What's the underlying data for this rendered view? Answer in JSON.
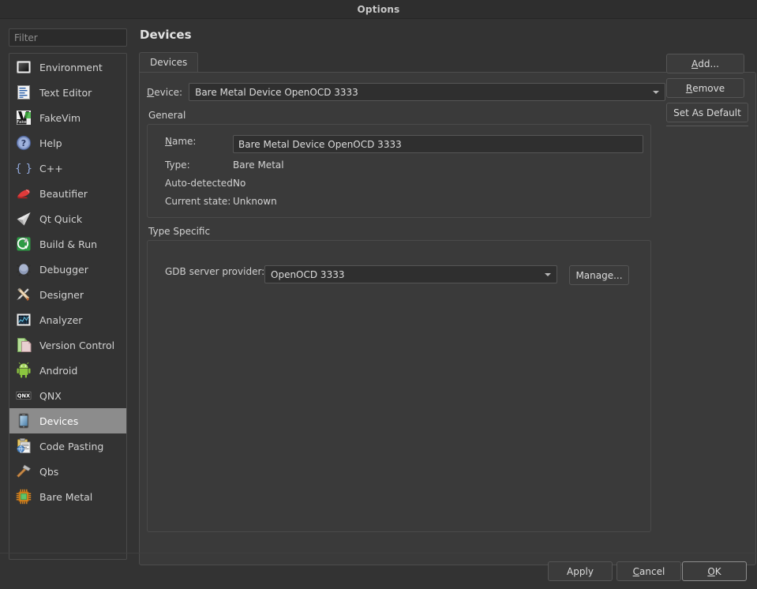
{
  "window": {
    "title": "Options"
  },
  "sidebar": {
    "filter": {
      "placeholder": "Filter",
      "value": ""
    },
    "items": [
      {
        "label": "Environment",
        "icon": "environment-icon",
        "selected": false
      },
      {
        "label": "Text Editor",
        "icon": "text-editor-icon",
        "selected": false
      },
      {
        "label": "FakeVim",
        "icon": "fakevim-icon",
        "selected": false
      },
      {
        "label": "Help",
        "icon": "help-icon",
        "selected": false
      },
      {
        "label": "C++",
        "icon": "cpp-icon",
        "selected": false
      },
      {
        "label": "Beautifier",
        "icon": "beautifier-icon",
        "selected": false
      },
      {
        "label": "Qt Quick",
        "icon": "qt-quick-icon",
        "selected": false
      },
      {
        "label": "Build & Run",
        "icon": "build-and-run-icon",
        "selected": false
      },
      {
        "label": "Debugger",
        "icon": "debugger-icon",
        "selected": false
      },
      {
        "label": "Designer",
        "icon": "designer-icon",
        "selected": false
      },
      {
        "label": "Analyzer",
        "icon": "analyzer-icon",
        "selected": false
      },
      {
        "label": "Version Control",
        "icon": "version-control-icon",
        "selected": false
      },
      {
        "label": "Android",
        "icon": "android-icon",
        "selected": false
      },
      {
        "label": "QNX",
        "icon": "qnx-icon",
        "selected": false
      },
      {
        "label": "Devices",
        "icon": "devices-icon",
        "selected": true
      },
      {
        "label": "Code Pasting",
        "icon": "code-pasting-icon",
        "selected": false
      },
      {
        "label": "Qbs",
        "icon": "qbs-icon",
        "selected": false
      },
      {
        "label": "Bare Metal",
        "icon": "bare-metal-icon",
        "selected": false
      }
    ]
  },
  "page": {
    "title": "Devices",
    "tabs": [
      {
        "label": "Devices",
        "active": true
      }
    ]
  },
  "device_selector": {
    "label_prefix": "D",
    "label_rest": "evice:",
    "value": "Bare Metal Device OpenOCD 3333"
  },
  "side_buttons": [
    {
      "name": "add-button",
      "mnemonic": "A",
      "rest": "dd..."
    },
    {
      "name": "remove-button",
      "mnemonic": "R",
      "rest": "emove"
    },
    {
      "name": "set-as-default-button",
      "mnemonic": "",
      "rest": "Set As Default"
    }
  ],
  "general": {
    "title": "General",
    "name_label_prefix": "N",
    "name_label_rest": "ame:",
    "name_value": "Bare Metal Device OpenOCD 3333",
    "rows": [
      {
        "label": "Type:",
        "value": "Bare Metal"
      },
      {
        "label": "Auto-detected:",
        "value": "No"
      },
      {
        "label": "Current state:",
        "value": "Unknown"
      }
    ]
  },
  "type_specific": {
    "title": "Type Specific",
    "gdb_label": "GDB server provider:",
    "gdb_value": "OpenOCD 3333",
    "manage_label": "Manage..."
  },
  "footer": {
    "apply": {
      "label": "Apply"
    },
    "cancel": {
      "mnemonic": "C",
      "rest": "ancel"
    },
    "ok": {
      "mnemonic": "O",
      "rest": "K"
    }
  },
  "colors": {
    "window_bg": "#333333",
    "titlebar_bg": "#2e2e2e",
    "panel_bg": "#3a3a3a",
    "input_bg": "#2f2f2f",
    "border": "#4a4a4a",
    "text": "#d2d2d2",
    "selection_bg": "#8c8c8c",
    "selection_text": "#ffffff"
  }
}
